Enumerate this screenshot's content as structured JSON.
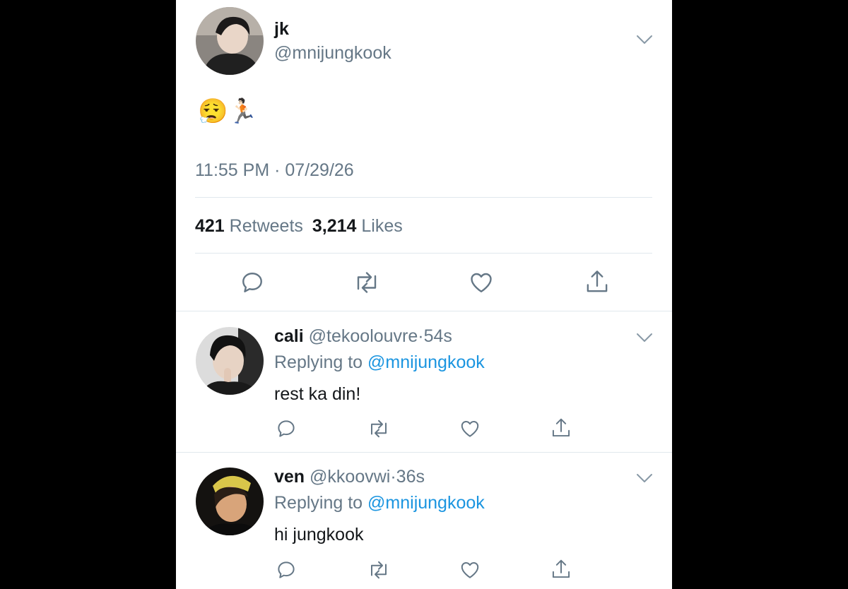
{
  "main_tweet": {
    "display_name": "jk",
    "handle": "@mnijungkook",
    "emoji": "😮‍💨🏃🏻",
    "time": "11:55 PM",
    "date_separator": "·",
    "date": "07/29/26",
    "retweet_count": "421",
    "retweet_label": "Retweets",
    "like_count": "3,214",
    "like_label": "Likes"
  },
  "replies": [
    {
      "display_name": "cali",
      "handle": "@tekoolouvre",
      "dot": "·",
      "age": "54s",
      "replying_prefix": "Replying to",
      "replying_to": "@mnijungkook",
      "body": "rest ka din!"
    },
    {
      "display_name": "ven",
      "handle": "@kkoovwi",
      "dot": "·",
      "age": "36s",
      "replying_prefix": "Replying to",
      "replying_to": "@mnijungkook",
      "body": "hi jungkook"
    }
  ],
  "icons": [
    "reply-icon",
    "retweet-icon",
    "like-icon",
    "share-icon",
    "chevron-down-icon"
  ],
  "colors": {
    "text": "#14171a",
    "secondary": "#657786",
    "link": "#1b95e0",
    "divider": "#e1e8ed",
    "background": "#ffffff"
  }
}
